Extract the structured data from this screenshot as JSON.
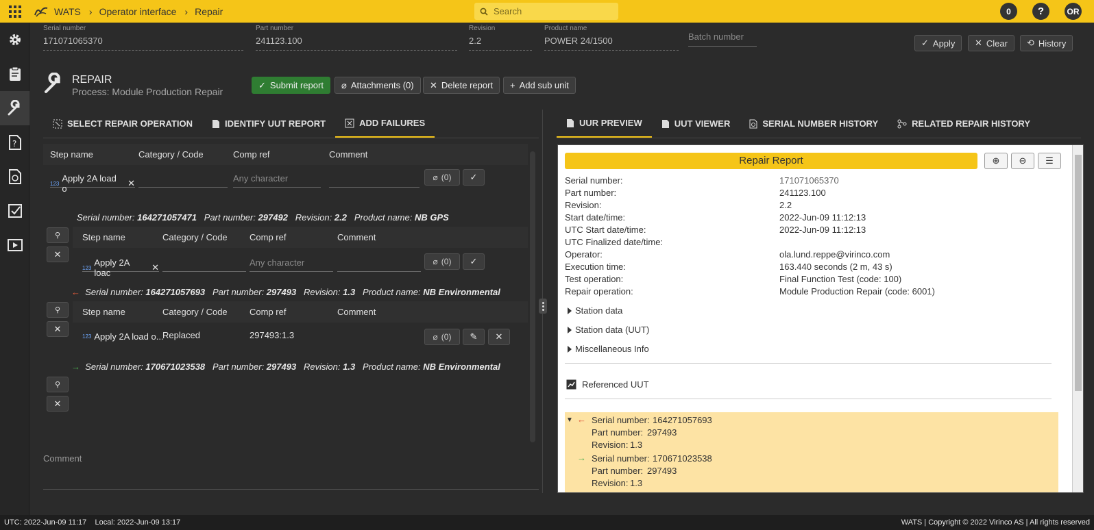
{
  "topbar": {
    "app_name": "WATS",
    "breadcrumb": [
      "Operator interface",
      "Repair"
    ],
    "search_placeholder": "Search",
    "notifications_count": "0",
    "help": "?",
    "user_initials": "OR",
    "accent_color": "#f5c518"
  },
  "sidebar": {
    "items": [
      "gear-icon",
      "clipboard-icon",
      "wrench-icon",
      "help-doc-icon",
      "history-icon",
      "checklist-icon",
      "play-icon"
    ],
    "active": "wrench-icon"
  },
  "fields": {
    "serial_label": "Serial number",
    "serial_value": "171071065370",
    "part_label": "Part number",
    "part_value": "241123.100",
    "revision_label": "Revision",
    "revision_value": "2.2",
    "product_label": "Product name",
    "product_value": "POWER 24/1500",
    "batch_placeholder": "Batch number"
  },
  "top_buttons": {
    "apply": "Apply",
    "clear": "Clear",
    "history": "History"
  },
  "repair": {
    "title": "REPAIR",
    "process": "Process: Module Production Repair",
    "submit": "Submit report",
    "attachments": "Attachments (0)",
    "delete": "Delete report",
    "add_sub_unit": "Add sub unit"
  },
  "left_tabs": [
    "SELECT REPAIR OPERATION",
    "IDENTIFY UUT REPORT",
    "ADD FAILURES"
  ],
  "table_headers": {
    "step": "Step name",
    "category": "Category / Code",
    "comp_ref": "Comp ref",
    "comment": "Comment"
  },
  "main_row": {
    "step": "Apply 2A load o",
    "comp_placeholder": "Any character",
    "att": "(0)"
  },
  "sub_units": [
    {
      "serial_label": "Serial number:",
      "serial": "164271057471",
      "part_label": "Part number:",
      "part": "297492",
      "rev_label": "Revision:",
      "rev": "2.2",
      "prod_label": "Product name:",
      "prod": "NB GPS",
      "step": "Apply 2A loac",
      "comp_placeholder": "Any character",
      "att": "(0)"
    },
    {
      "serial_label": "Serial number:",
      "serial": "164271057693",
      "part_label": "Part number:",
      "part": "297493",
      "rev_label": "Revision:",
      "rev": "1.3",
      "prod_label": "Product name:",
      "prod": "NB Environmental",
      "step": "Apply 2A load o...",
      "category": "Replaced",
      "comp_ref": "297493:1.3",
      "att": "(0)"
    },
    {
      "serial_label": "Serial number:",
      "serial": "170671023538",
      "part_label": "Part number:",
      "part": "297493",
      "rev_label": "Revision:",
      "rev": "1.3",
      "prod_label": "Product name:",
      "prod": "NB Environmental"
    }
  ],
  "comment_label": "Comment",
  "right_tabs": [
    "UUR PREVIEW",
    "UUT VIEWER",
    "SERIAL NUMBER HISTORY",
    "RELATED REPAIR HISTORY"
  ],
  "preview": {
    "title": "Repair Report",
    "rows": [
      {
        "k": "Serial number:",
        "v": "171071065370"
      },
      {
        "k": "Part number:",
        "v": "241123.100"
      },
      {
        "k": "Revision:",
        "v": "2.2"
      },
      {
        "k": "Start date/time:",
        "v": "2022-Jun-09 11:12:13"
      },
      {
        "k": "UTC Start date/time:",
        "v": "2022-Jun-09 11:12:13"
      },
      {
        "k": "UTC Finalized date/time:",
        "v": ""
      },
      {
        "k": "Operator:",
        "v": "ola.lund.reppe@virinco.com"
      },
      {
        "k": "Execution time:",
        "v": "163.440 seconds (2 m, 43 s)"
      },
      {
        "k": "Test operation:",
        "v": "Final Function Test (code: 100)"
      },
      {
        "k": "Repair operation:",
        "v": "Module Production Repair (code: 6001)"
      }
    ],
    "sections": [
      "Station data",
      "Station data (UUT)",
      "Miscellaneous Info"
    ],
    "referenced_uut": "Referenced UUT",
    "refs": [
      {
        "serial_label": "Serial number:",
        "serial": "164271057693",
        "part_label": "Part number:",
        "part": "297493",
        "rev_label": "Revision:",
        "rev": "1.3"
      },
      {
        "serial_label": "Serial number:",
        "serial": "170671023538",
        "part_label": "Part number:",
        "part": "297493",
        "rev_label": "Revision:",
        "rev": "1.3"
      }
    ]
  },
  "footer": {
    "utc": "UTC: 2022-Jun-09 11:17",
    "local": "Local: 2022-Jun-09 13:17",
    "copyright": "WATS | Copyright © 2022 Virinco AS | All rights reserved"
  }
}
